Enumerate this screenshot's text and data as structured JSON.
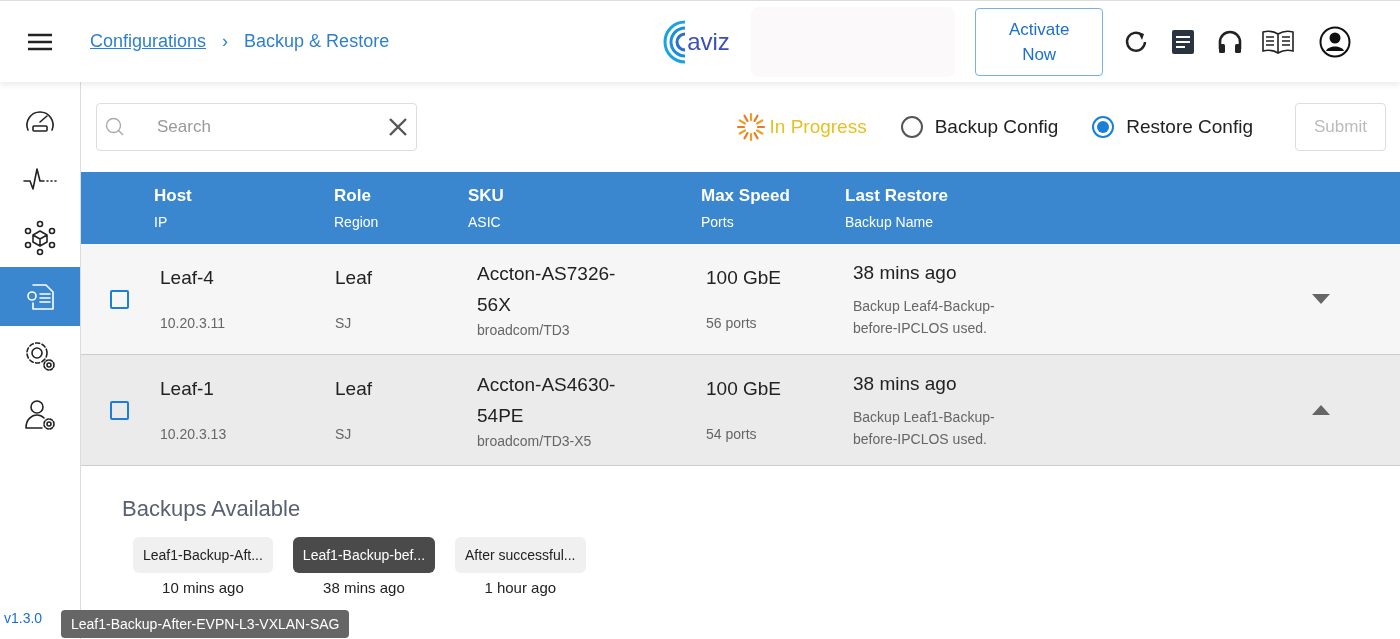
{
  "header": {
    "breadcrumbs": [
      {
        "label": "Configurations",
        "link": true
      },
      {
        "label": "Backup & Restore",
        "link": false
      }
    ],
    "breadcrumb_separator": "›",
    "logo": "aviz",
    "activate_button": "Activate\nNow"
  },
  "sidebar": {
    "items": [
      {
        "kind": "gauge",
        "selected": false
      },
      {
        "kind": "pulse",
        "selected": false
      },
      {
        "kind": "network",
        "selected": false
      },
      {
        "kind": "document",
        "selected": true
      },
      {
        "kind": "gears",
        "selected": false
      },
      {
        "kind": "user",
        "selected": false
      }
    ],
    "version": "v1.3.0"
  },
  "toolbar": {
    "search": {
      "placeholder": "Search"
    },
    "status": "In Progress",
    "modes": [
      {
        "label": "Backup Config",
        "selected": false
      },
      {
        "label": "Restore Config",
        "selected": true
      }
    ],
    "submit": {
      "label": "Submit",
      "disabled": true
    }
  },
  "table": {
    "columns": [
      {
        "title": "Host",
        "subtitle": "IP"
      },
      {
        "title": "Role",
        "subtitle": "Region"
      },
      {
        "title": "SKU",
        "subtitle": "ASIC"
      },
      {
        "title": "Max Speed",
        "subtitle": "Ports"
      },
      {
        "title": "Last Restore",
        "subtitle": "Backup Name"
      }
    ],
    "rows": [
      {
        "checked": false,
        "expanded": false,
        "host": "Leaf-4",
        "ip": "10.20.3.11",
        "role": "Leaf",
        "region": "SJ",
        "sku": "Accton-AS7326-\n56X",
        "asic": "broadcom/TD3",
        "speed": "100 GbE",
        "ports": "56 ports",
        "last_restore": "38 mins ago",
        "backup_name": "Backup Leaf4-Backup-\nbefore-IPCLOS used."
      },
      {
        "checked": false,
        "expanded": true,
        "host": "Leaf-1",
        "ip": "10.20.3.13",
        "role": "Leaf",
        "region": "SJ",
        "sku": "Accton-AS4630-\n54PE",
        "asic": "broadcom/TD3-X5",
        "speed": "100 GbE",
        "ports": "54 ports",
        "last_restore": "38 mins ago",
        "backup_name": "Backup Leaf1-Backup-\nbefore-IPCLOS used."
      }
    ]
  },
  "backups": {
    "title": "Backups Available",
    "items": [
      {
        "label": "Leaf1-Backup-Aft...",
        "time": "10 mins ago",
        "selected": false
      },
      {
        "label": "Leaf1-Backup-bef...",
        "time": "38 mins ago",
        "selected": true
      },
      {
        "label": "After successful...",
        "time": "1 hour ago",
        "selected": false
      }
    ],
    "tooltip": "Leaf1-Backup-After-EVPN-L3-VXLAN-SAG"
  }
}
